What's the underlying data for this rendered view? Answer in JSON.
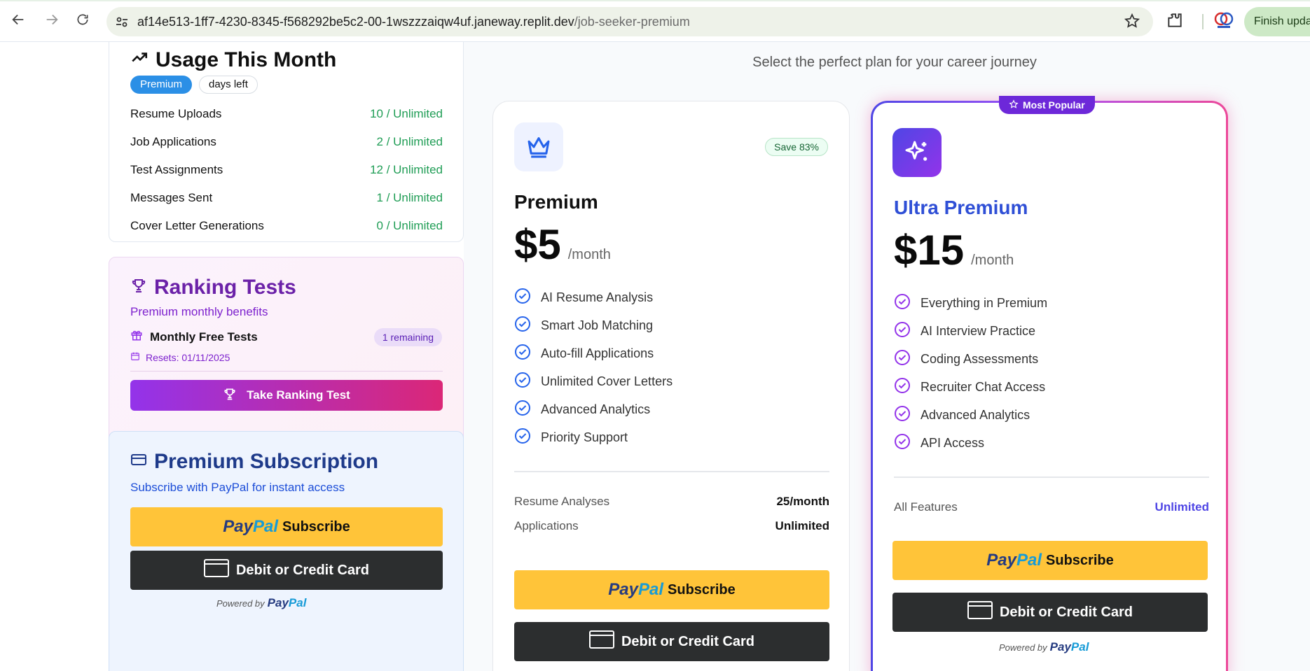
{
  "browser": {
    "url_domain": "af14e513-1ff7-4230-8345-f568292be5c2-00-1wszzzaiqw4uf.janeway.replit.dev",
    "url_path": "/job-seeker-premium",
    "finish_update_label": "Finish updat"
  },
  "usage": {
    "title": "Usage This Month",
    "badge_plan": "Premium",
    "badge_days": "days left",
    "rows": [
      {
        "label": "Resume Uploads",
        "value": "10 / Unlimited"
      },
      {
        "label": "Job Applications",
        "value": "2 / Unlimited"
      },
      {
        "label": "Test Assignments",
        "value": "12 / Unlimited"
      },
      {
        "label": "Messages Sent",
        "value": "1 / Unlimited"
      },
      {
        "label": "Cover Letter Generations",
        "value": "0 / Unlimited"
      }
    ]
  },
  "ranking": {
    "title": "Ranking Tests",
    "subtitle": "Premium monthly benefits",
    "free_tests_label": "Monthly Free Tests",
    "remaining": "1 remaining",
    "resets": "Resets: 01/11/2025",
    "button_label": "Take Ranking Test"
  },
  "subscription": {
    "title": "Premium Subscription",
    "subtitle": "Subscribe with PayPal for instant access"
  },
  "paypal": {
    "logo_part1": "Pay",
    "logo_part2": "Pal",
    "subscribe": "Subscribe",
    "card_label": "Debit or Credit Card",
    "powered_by": "Powered by"
  },
  "plans": {
    "tagline": "Select the perfect plan for your career journey",
    "premium": {
      "name": "Premium",
      "save_badge": "Save 83%",
      "price": "$5",
      "period": "/month",
      "features": [
        "AI Resume Analysis",
        "Smart Job Matching",
        "Auto-fill Applications",
        "Unlimited Cover Letters",
        "Advanced Analytics",
        "Priority Support"
      ],
      "stats": [
        {
          "label": "Resume Analyses",
          "value": "25/month"
        },
        {
          "label": "Applications",
          "value": "Unlimited"
        }
      ]
    },
    "ultra": {
      "badge": "Most Popular",
      "name": "Ultra Premium",
      "price": "$15",
      "period": "/month",
      "features": [
        "Everything in Premium",
        "AI Interview Practice",
        "Coding Assessments",
        "Recruiter Chat Access",
        "Advanced Analytics",
        "API Access"
      ],
      "stats": [
        {
          "label": "All Features",
          "value": "Unlimited"
        }
      ]
    }
  },
  "colors": {
    "paypal_yellow": "#ffc439",
    "paypal_dark_blue": "#253b80",
    "paypal_light_blue": "#179bd7",
    "ultra_accent": "#4f46e5",
    "ranking_purple": "#6b21a8",
    "usage_green": "#1f9d55"
  },
  "icons": [
    "back-arrow-icon",
    "forward-arrow-icon",
    "reload-icon",
    "site-settings-icon",
    "bookmark-star-icon",
    "extensions-icon",
    "profile-icon",
    "trending-up-icon",
    "trophy-icon",
    "gift-icon",
    "calendar-icon",
    "credit-card-icon",
    "crown-icon",
    "sparkles-icon",
    "check-circle-icon",
    "star-icon"
  ]
}
